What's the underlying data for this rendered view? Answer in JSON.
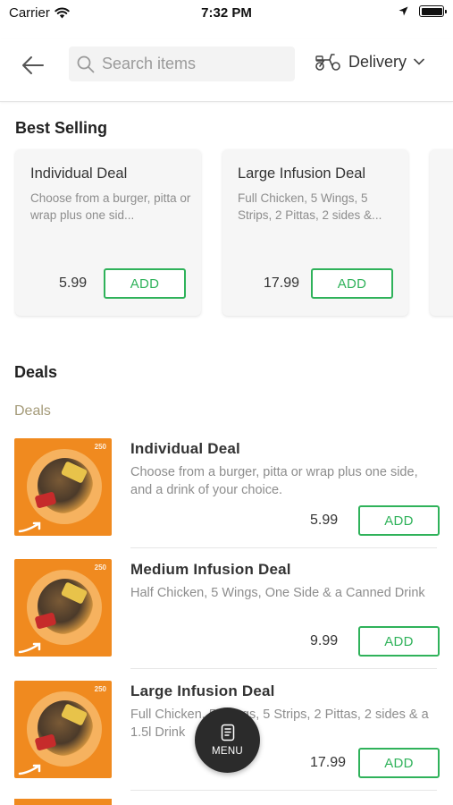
{
  "status_bar": {
    "carrier": "Carrier",
    "time": "7:32 PM"
  },
  "header": {
    "search_placeholder": "Search items",
    "delivery_label": "Delivery"
  },
  "best_selling": {
    "title": "Best Selling",
    "cards": [
      {
        "name": "Individual Deal",
        "description": "Choose from a burger, pitta or wrap plus one sid...",
        "price": "5.99",
        "add_label": "ADD"
      },
      {
        "name": "Large Infusion Deal",
        "description": "Full Chicken, 5 Wings, 5 Strips, 2 Pittas, 2 sides &...",
        "price": "17.99",
        "add_label": "ADD"
      }
    ]
  },
  "deals": {
    "title": "Deals",
    "subcategory": "Deals",
    "items": [
      {
        "name": "Individual Deal",
        "description": "Choose from a burger, pitta or wrap plus one side, and a drink of your choice.",
        "price": "5.99",
        "add_label": "ADD",
        "badge": "250"
      },
      {
        "name": "Medium Infusion Deal",
        "description": "Half Chicken, 5 Wings, One Side & a Canned Drink",
        "price": "9.99",
        "add_label": "ADD",
        "badge": "250"
      },
      {
        "name": "Large Infusion Deal",
        "description": "Full Chicken, 5 Wings, 5 Strips, 2 Pittas, 2 sides & a 1.5l Drink",
        "price": "17.99",
        "add_label": "ADD",
        "badge": "250"
      }
    ]
  },
  "menu_button": {
    "label": "MENU"
  },
  "colors": {
    "accent_green": "#2fb25a",
    "thumbnail_orange": "#f08a1f",
    "subcategory_tan": "#a49a78",
    "fab_dark": "#2b2b2b"
  },
  "icons": {
    "back": "arrow-left-icon",
    "search": "search-icon",
    "delivery": "scooter-icon",
    "dropdown": "chevron-down-icon",
    "menu": "menu-card-icon"
  }
}
